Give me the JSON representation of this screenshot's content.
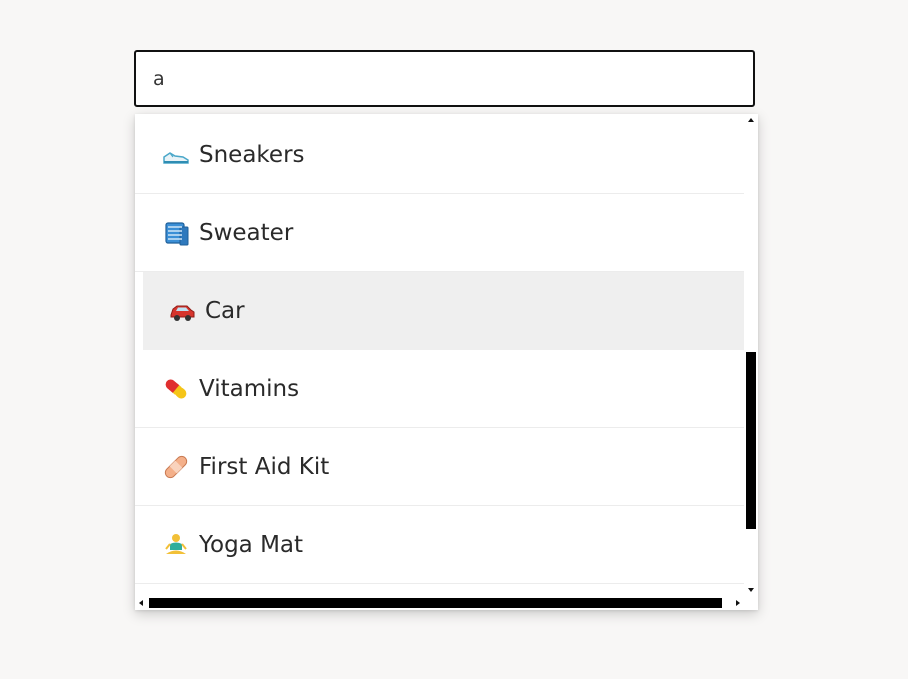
{
  "search": {
    "value": "a"
  },
  "dropdown": {
    "items": [
      {
        "label": "Sneakers",
        "icon": "sneaker-icon"
      },
      {
        "label": "Sweater",
        "icon": "sweater-icon"
      },
      {
        "label": "Car",
        "icon": "car-icon",
        "highlighted": true
      },
      {
        "label": "Vitamins",
        "icon": "pill-icon"
      },
      {
        "label": "First Aid Kit",
        "icon": "bandage-icon"
      },
      {
        "label": "Yoga Mat",
        "icon": "yoga-icon"
      }
    ],
    "highlight_color": "#efefef"
  },
  "colors": {
    "page_background": "#f8f7f6",
    "input_border": "#111111",
    "scrollbar_thumb": "#000000"
  }
}
